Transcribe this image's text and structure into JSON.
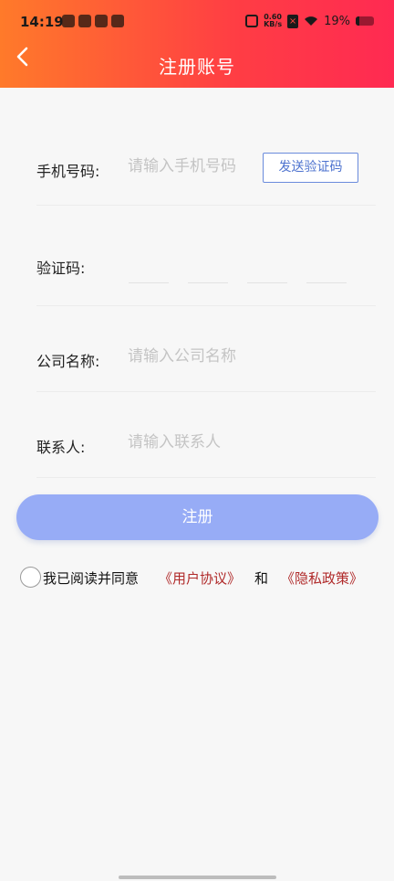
{
  "status_bar": {
    "time": "14:19",
    "net_speed_value": "0.60",
    "net_speed_unit": "KB/s",
    "battery_percent": "19%",
    "battery_level": 0.19
  },
  "header": {
    "title": "注册账号",
    "back_icon": "chevron-left-icon"
  },
  "form": {
    "phone": {
      "label": "手机号码:",
      "placeholder": "请输入手机号码",
      "send_code_label": "发送验证码"
    },
    "verify_code": {
      "label": "验证码:",
      "boxes": 4
    },
    "company": {
      "label": "公司名称:",
      "placeholder": "请输入公司名称"
    },
    "contact": {
      "label": "联系人:",
      "placeholder": "请输入联系人"
    }
  },
  "register_button": "注册",
  "agreement": {
    "prefix": "我已阅读并同意",
    "user_agreement": "《用户协议》",
    "and": "和",
    "privacy_policy": "《隐私政策》",
    "checked": false
  },
  "colors": {
    "header_gradient_start": "#ff7a2a",
    "header_gradient_end": "#ff2a52",
    "button": "#97acf6",
    "link": "#b02a2a",
    "send_code": "#4e73cf"
  }
}
